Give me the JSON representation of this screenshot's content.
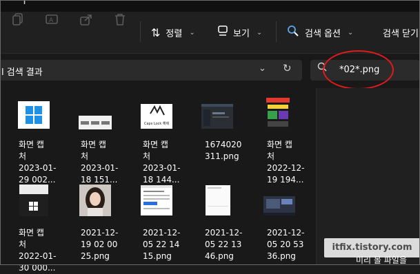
{
  "tab": {
    "plus": "+"
  },
  "toolbar": {
    "sort_label": "정렬",
    "view_label": "보기",
    "search_options_label": "검색 옵션",
    "close_search_label": "검색 닫기"
  },
  "address": {
    "text": "l 검색 결과"
  },
  "search": {
    "query": "*02*.png"
  },
  "files": [
    {
      "label": "화면 캡\n처\n2023-01-\n29 002...",
      "thumb": "windows-logo"
    },
    {
      "label": "화면 캡\n처\n2023-01-\n18 151...",
      "thumb": "white-ui"
    },
    {
      "label": "화면 캡\n처\n2023-01-\n18 144...",
      "thumb": "capslock"
    },
    {
      "label": "1674020\n311.png",
      "thumb": "dark-app"
    },
    {
      "label": "화면 캡\n처\n2022-12-\n19 194...",
      "thumb": "colorful-site"
    },
    {
      "label": "화면 캡\n처\n2022-01-\n30 000...",
      "thumb": "windows-dark"
    },
    {
      "label": "2021-12-\n19 02 00\n25.png",
      "thumb": "portrait"
    },
    {
      "label": "2021-12-\n05 22 14\n15.png",
      "thumb": "web-page"
    },
    {
      "label": "2021-12-\n05 22 13\n46.png",
      "thumb": "blank-doc"
    },
    {
      "label": "2021-12-\n05 20 53\n36.png",
      "thumb": "dark-desktop"
    }
  ],
  "capslock_text": "Caps Lock 해제",
  "watermark": "itfix.tistory.com",
  "preview": {
    "text": "미리 볼 파일을"
  },
  "colors": {
    "annotation": "#e11b1b",
    "background": "#191919",
    "toolbar": "#202020"
  }
}
